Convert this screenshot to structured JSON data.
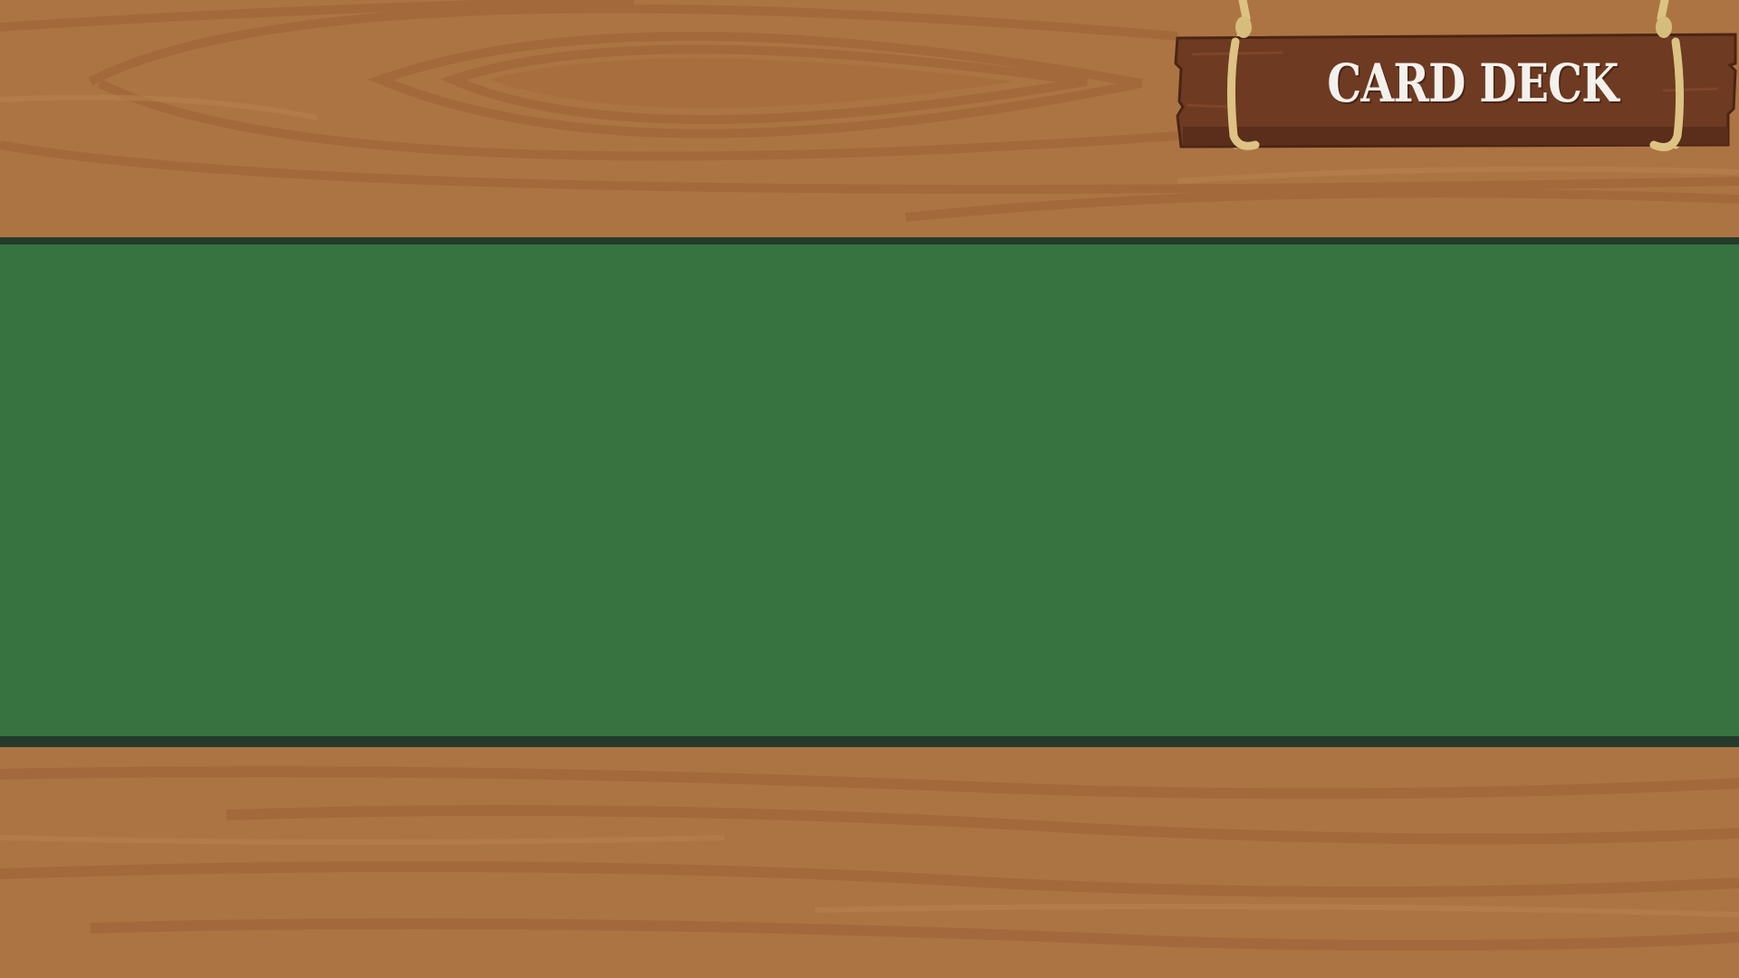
{
  "sign": {
    "label": "CARD DECK",
    "icon": "wooden-sign"
  },
  "colors": {
    "wood": "#ad7443",
    "wood_grain": "#9e6438",
    "felt": "#367340",
    "felt_border": "#253b2b",
    "sign_wood": "#6e3a22",
    "rope": "#dcc384",
    "sign_text": "#f4f1ec"
  }
}
